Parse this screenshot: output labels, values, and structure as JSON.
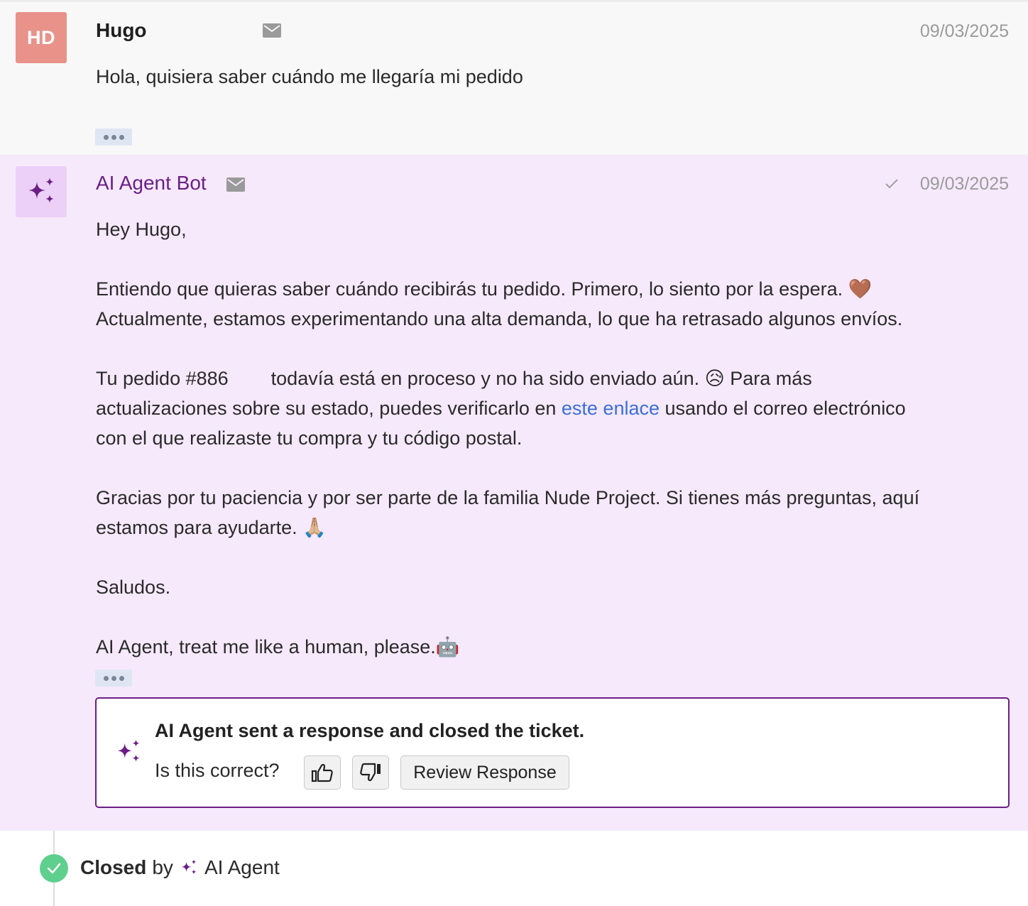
{
  "customer_message": {
    "avatar_initials": "HD",
    "sender": "Hugo",
    "date": "09/03/2025",
    "body": "Hola, quisiera saber cuándo me llegaría mi pedido"
  },
  "bot_message": {
    "sender": "AI Agent Bot",
    "date": "09/03/2025",
    "greeting": "Hey Hugo,",
    "para1": "Entiendo que quieras saber cuándo recibirás tu pedido. Primero, lo siento por la espera. 🤎\nActualmente, estamos experimentando una alta demanda, lo que ha retrasado algunos envíos.",
    "para2_before_link": "Tu pedido #886        todavía está en proceso y no ha sido enviado aún. 😥 Para más\nactualizaciones sobre su estado, puedes verificarlo en ",
    "para2_link": "este enlace",
    "para2_after_link": " usando el correo electrónico\ncon el que realizaste tu compra y tu código postal.",
    "para3": "Gracias por tu paciencia y por ser parte de la familia Nude Project. Si tienes más preguntas, aquí\nestamos para ayudarte. 🙏🏼",
    "signoff": "Saludos.",
    "signature": "AI Agent, treat me like a human, please.🤖"
  },
  "ai_card": {
    "title": "AI Agent sent a response and closed the ticket.",
    "question": "Is this correct?",
    "review_label": "Review Response"
  },
  "closed_event": {
    "status": "Closed",
    "by": "by",
    "actor": "AI Agent"
  },
  "colors": {
    "bot_purple": "#6b1f85",
    "bot_bg": "#f6e9fc",
    "avatar_hd": "#e8928a",
    "link": "#3b6fd8",
    "success_green": "#5fcf8d"
  },
  "icons": [
    "envelope-icon",
    "sparkle-icon",
    "checkmark-icon",
    "thumbs-up-icon",
    "thumbs-down-icon",
    "ellipsis-icon"
  ]
}
